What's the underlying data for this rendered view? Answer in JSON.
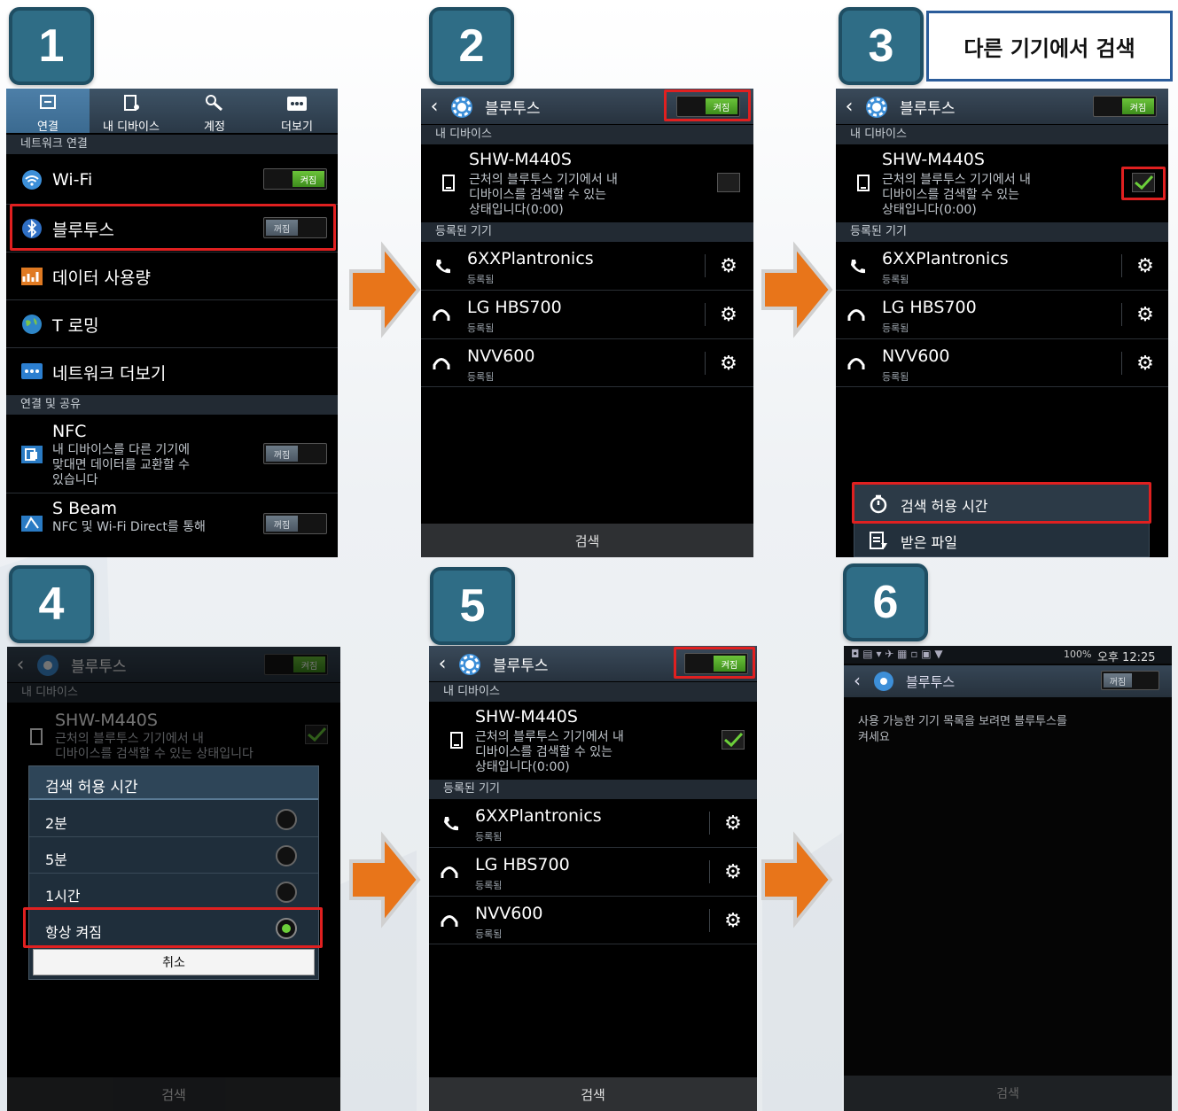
{
  "callout": "다른 기기에서 검색",
  "steps": [
    "1",
    "2",
    "3",
    "4",
    "5",
    "6"
  ],
  "colors": {
    "accent_red": "#e02020",
    "badge": "#2f6d86",
    "arrow": "#e8751a",
    "toggle_on": "#5db332"
  },
  "screen1": {
    "tabs": [
      {
        "label": "연결",
        "icon": "link-icon"
      },
      {
        "label": "내 디바이스",
        "icon": "device-icon"
      },
      {
        "label": "계정",
        "icon": "key-icon"
      },
      {
        "label": "더보기",
        "icon": "more-icon"
      }
    ],
    "section_network": "네트워크 연결",
    "wifi": {
      "label": "Wi-Fi",
      "toggle": "켜짐"
    },
    "bluetooth": {
      "label": "블루투스",
      "toggle": "꺼짐"
    },
    "data_usage": "데이터 사용량",
    "roaming": "T 로밍",
    "more_networks": "네트워크 더보기",
    "section_share": "연결 및 공유",
    "nfc": {
      "label": "NFC",
      "desc_1": "내 디바이스를 다른 기기에",
      "desc_2": "맞대면 데이터를 교환할 수",
      "desc_3": "있습니다",
      "toggle": "꺼짐"
    },
    "sbeam": {
      "label": "S Beam",
      "desc": "NFC 및 Wi-Fi Direct를 통해",
      "toggle": "꺼짐"
    }
  },
  "bt": {
    "title": "블루투스",
    "toggle_on": "켜짐",
    "toggle_off": "꺼짐",
    "my_device_header": "내 디바이스",
    "device_name": "SHW-M440S",
    "device_desc_1": "근처의 블루투스 기기에서 내",
    "device_desc_2": "디바이스를 검색할 수 있는",
    "device_desc_3": "상태입니다(0:00)",
    "registered_header": "등록된 기기",
    "registered_status": "등록됨",
    "devices": [
      "6XXPlantronics",
      "LG HBS700",
      "NVV600"
    ],
    "search": "검색"
  },
  "screen3": {
    "menu": [
      "검색 허용 시간",
      "받은 파일"
    ]
  },
  "screen4": {
    "device_desc_1": "근처의 블루투스 기기에서 내",
    "device_desc_2": "디바이스를 검색할 수 있는 상태입니다",
    "dialog_title": "검색 허용 시간",
    "options": [
      "2분",
      "5분",
      "1시간",
      "항상 켜짐"
    ],
    "selected": "항상 켜짐",
    "cancel": "취소"
  },
  "screen6": {
    "status_time": "오후 12:25",
    "status_battery": "100%",
    "title": "블루투스",
    "message_1": "사용 가능한 기기 목록을 보려면 블루투스를",
    "message_2": "켜세요"
  }
}
